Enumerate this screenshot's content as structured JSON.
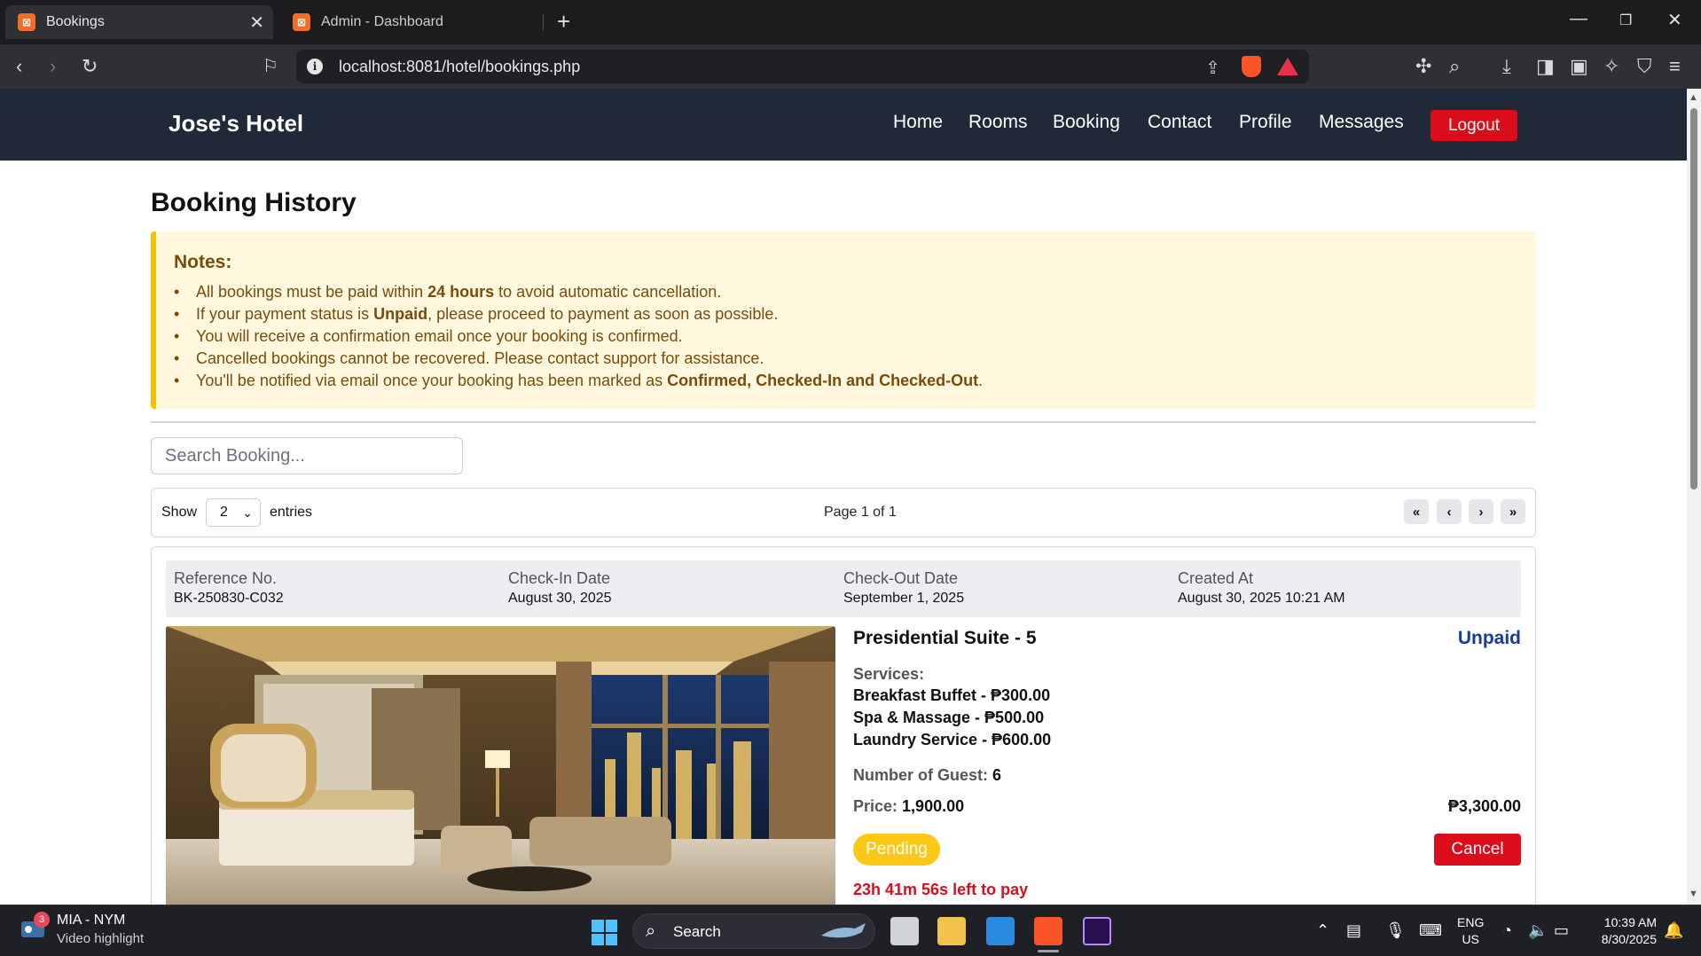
{
  "browser": {
    "tabs": [
      {
        "title": "Bookings",
        "active": true
      },
      {
        "title": "Admin - Dashboard",
        "active": false
      }
    ],
    "url": "localhost:8081/hotel/bookings.php"
  },
  "navbar": {
    "brand": "Jose's Hotel",
    "links": [
      "Home",
      "Rooms",
      "Booking",
      "Contact",
      "Profile",
      "Messages"
    ],
    "logout": "Logout"
  },
  "page": {
    "title": "Booking History",
    "notes": {
      "heading": "Notes:",
      "items": [
        {
          "pre": "All bookings must be paid within ",
          "bold": "24 hours",
          "post": " to avoid automatic cancellation."
        },
        {
          "pre": "If your payment status is ",
          "bold": "Unpaid",
          "post": ", please proceed to payment as soon as possible."
        },
        {
          "pre": "You will receive a confirmation email once your booking is confirmed.",
          "bold": "",
          "post": ""
        },
        {
          "pre": "Cancelled bookings cannot be recovered. Please contact support for assistance.",
          "bold": "",
          "post": ""
        },
        {
          "pre": "You'll be notified via email once your booking has been marked as ",
          "bold": "Confirmed, Checked-In and Checked-Out",
          "post": "."
        }
      ]
    },
    "search_placeholder": "Search Booking...",
    "pager": {
      "show": "Show",
      "entries_value": "2",
      "entries": "entries",
      "page_info": "Page 1 of 1",
      "buttons": [
        "«",
        "‹",
        "›",
        "»"
      ]
    },
    "booking": {
      "meta": [
        {
          "label": "Reference No.",
          "value": "BK-250830-C032"
        },
        {
          "label": "Check-In Date",
          "value": "August 30, 2025"
        },
        {
          "label": "Check-Out Date",
          "value": "September 1, 2025"
        },
        {
          "label": "Created At",
          "value": "August 30, 2025 10:21 AM"
        }
      ],
      "room": "Presidential Suite - 5",
      "payment_status": "Unpaid",
      "services_label": "Services:",
      "services": [
        "Breakfast Buffet - ₱300.00",
        "Spa & Massage - ₱500.00",
        "Laundry Service - ₱600.00"
      ],
      "guests_label": "Number of Guest:",
      "guests": "6",
      "price_label": "Price:",
      "price": "1,900.00",
      "total": "₱3,300.00",
      "status": "Pending",
      "cancel": "Cancel",
      "countdown": "23h 41m 56s left to pay"
    }
  },
  "taskbar": {
    "widget_title": "MIA - NYM",
    "widget_sub": "Video highlight",
    "badge": "3",
    "search": "Search",
    "lang1": "ENG",
    "lang2": "US",
    "time": "10:39 AM",
    "date": "8/30/2025"
  },
  "colors": {
    "navbar": "#1f2937",
    "accent_red": "#dc0d1a",
    "pending_yellow": "#fcc817",
    "unpaid_blue": "#1b3aa0"
  }
}
